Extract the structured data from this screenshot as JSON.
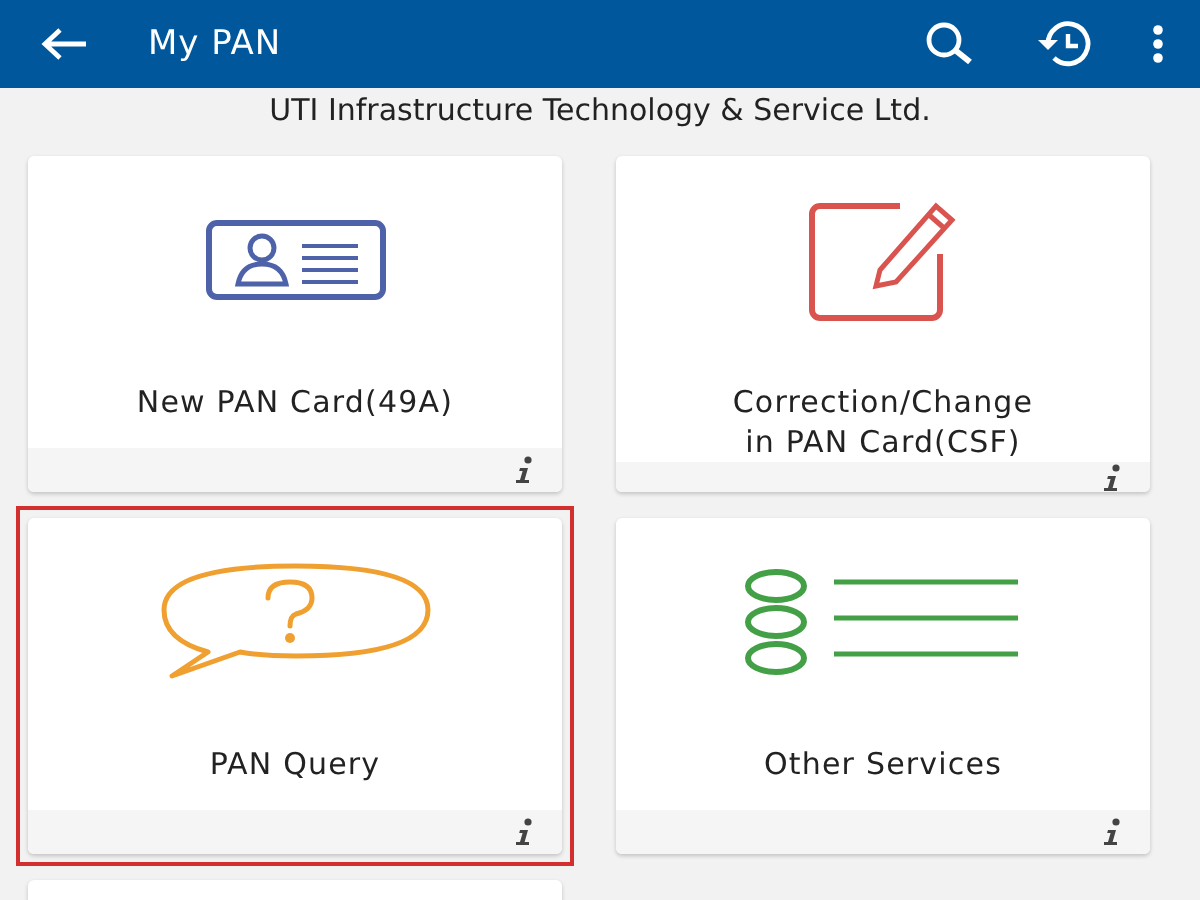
{
  "app_bar": {
    "title": "My PAN"
  },
  "subtitle": "UTI Infrastructure Technology & Service Ltd.",
  "cards": [
    {
      "kind": "id-card",
      "label": "New PAN Card(49A)",
      "selected": false
    },
    {
      "kind": "edit",
      "label": "Correction/Change\nin PAN Card(CSF)",
      "selected": false
    },
    {
      "kind": "query",
      "label": "PAN Query",
      "selected": true
    },
    {
      "kind": "list",
      "label": "Other Services",
      "selected": false
    },
    {
      "kind": "blank",
      "selected": false
    }
  ]
}
